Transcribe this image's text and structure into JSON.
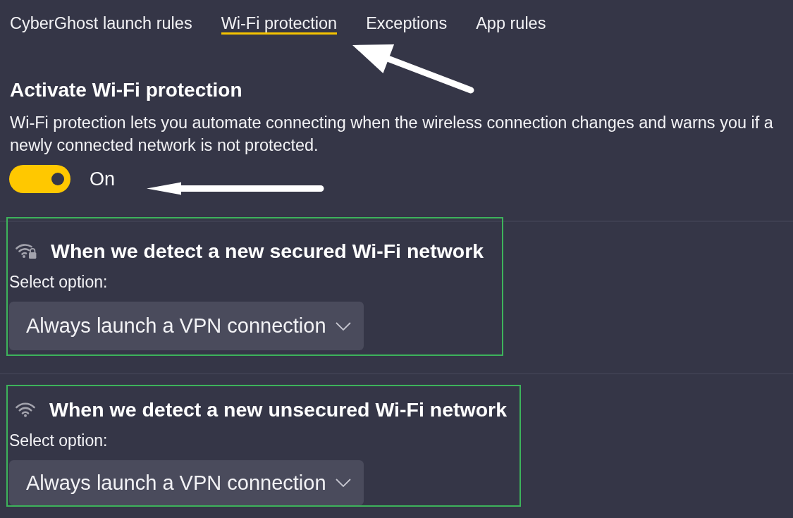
{
  "tabs": [
    {
      "label": "CyberGhost launch rules",
      "selected": false
    },
    {
      "label": "Wi-Fi protection",
      "selected": true
    },
    {
      "label": "Exceptions",
      "selected": false
    },
    {
      "label": "App rules",
      "selected": false
    }
  ],
  "wifi_protection": {
    "title": "Activate Wi-Fi protection",
    "description": "Wi-Fi protection lets you automate connecting when the wireless connection changes and warns you if a newly connected network is not protected.",
    "toggle": {
      "on": true,
      "label": "On"
    }
  },
  "sections": [
    {
      "kind": "secured",
      "highlighted": true,
      "title": "When we detect a new secured Wi-Fi network",
      "field_label": "Select option:",
      "dropdown": {
        "value": "Always launch a VPN connection"
      }
    },
    {
      "kind": "unsecured",
      "highlighted": true,
      "title": "When we detect a new unsecured Wi-Fi network",
      "field_label": "Select option:",
      "dropdown": {
        "value": "Always launch a VPN connection"
      }
    }
  ]
}
